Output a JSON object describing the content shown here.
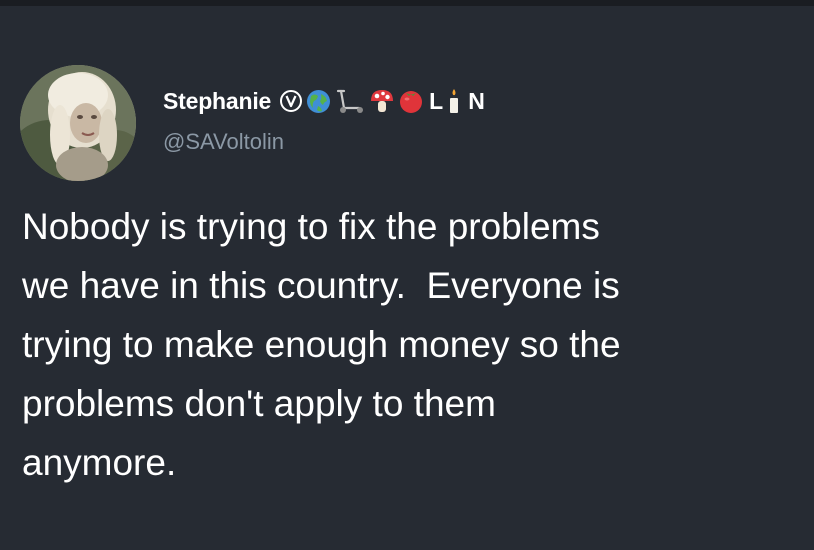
{
  "tweet": {
    "author": {
      "display_name": "Stephanie",
      "handle": "@SAVoltolin",
      "name_letters": [
        "L",
        "N"
      ],
      "name_icons": [
        "vegan-v-circle-icon",
        "globe-icon",
        "scooter-icon",
        "mushroom-icon",
        "tomato-icon",
        "candle-icon"
      ]
    },
    "text": "Nobody is trying to fix the problems\nwe have in this country.  Everyone is\ntrying to make enough money so the\nproblems don't apply to them\nanymore."
  },
  "colors": {
    "background": "#262b33",
    "text": "#ffffff",
    "handle": "#8b98a5"
  }
}
